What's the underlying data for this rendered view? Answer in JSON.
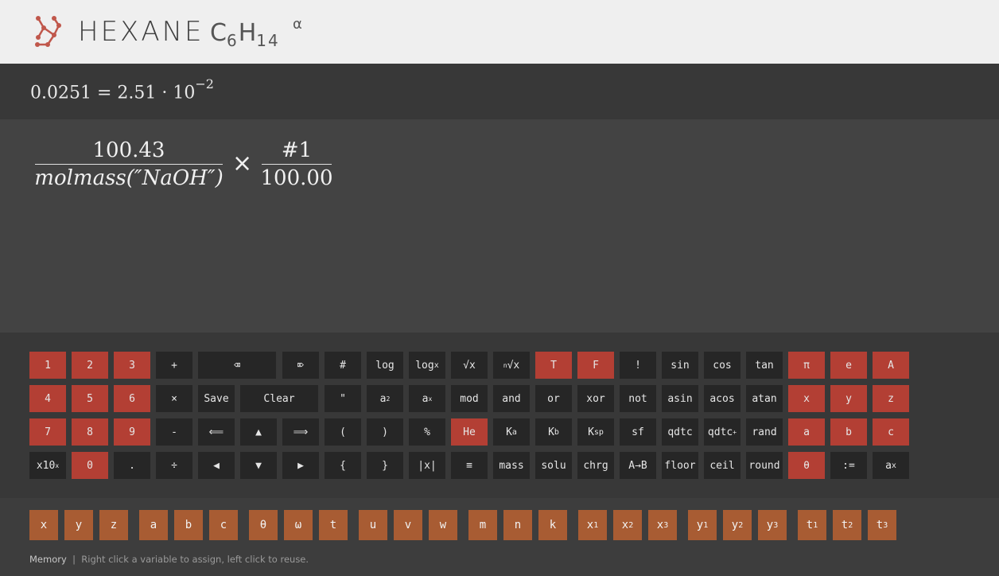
{
  "header": {
    "title": "HEXANE",
    "formula_c": "C",
    "formula_c_sub": "6",
    "formula_h": "H",
    "formula_h_sub": "14",
    "badge": "α"
  },
  "result": {
    "value": "0.0251 = 2.51 · 10",
    "exponent": "−2"
  },
  "expression": {
    "frac1_num": "100.43",
    "frac1_den": "molmass(″NaOH″)",
    "operator": "×",
    "frac2_num": "#1",
    "frac2_den": "100.00"
  },
  "keys": {
    "k1": "1",
    "k2": "2",
    "k3": "3",
    "plus": "+",
    "backspace": "⌫",
    "delete": "⌦",
    "hash": "#",
    "log": "log",
    "logx": "log",
    "logx_sub": "x",
    "sqrt": "√x",
    "nroot": "√x",
    "nroot_sup": "n",
    "true": "T",
    "false": "F",
    "fact": "!",
    "sin": "sin",
    "cos": "cos",
    "tan": "tan",
    "pi": "π",
    "e": "e",
    "A": "A",
    "k4": "4",
    "k5": "5",
    "k6": "6",
    "mul": "×",
    "save": "Save",
    "clear": "Clear",
    "quote": "\"",
    "sq": "a",
    "sq_sup": "2",
    "pow": "a",
    "pow_sup": "x",
    "mod": "mod",
    "and": "and",
    "or": "or",
    "xor": "xor",
    "not": "not",
    "asin": "asin",
    "acos": "acos",
    "atan": "atan",
    "x": "x",
    "y": "y",
    "z": "z",
    "k7": "7",
    "k8": "8",
    "k9": "9",
    "minus": "-",
    "left_dbl": "⟸",
    "up": "▲",
    "right_dbl": "⟹",
    "lparen": "(",
    "rparen": ")",
    "percent": "%",
    "he": "He",
    "ka": "K",
    "ka_sub": "a",
    "kb": "K",
    "kb_sub": "b",
    "ksp": "K",
    "ksp_sub": "sp",
    "sf": "sf",
    "qdtc": "qdtc",
    "qdtcp": "qdtc",
    "qdtcp_sup": "+",
    "rand": "rand",
    "a": "a",
    "b": "b",
    "c": "c",
    "x10": "x10",
    "x10_sup": "x",
    "k0": "0",
    "dot": ".",
    "div": "÷",
    "left": "◀",
    "down": "▼",
    "right": "▶",
    "lbrace": "{",
    "rbrace": "}",
    "abs": "|x|",
    "menu": "≡",
    "mass": "mass",
    "solu": "solu",
    "chrg": "chrg",
    "atob": "A→B",
    "floor": "floor",
    "ceil": "ceil",
    "round": "round",
    "theta": "θ",
    "assign": ":=",
    "ax": "a",
    "ax_sub": "x"
  },
  "memory": {
    "vars": [
      "x",
      "y",
      "z",
      "a",
      "b",
      "c",
      "θ",
      "ω",
      "t",
      "u",
      "v",
      "w",
      "m",
      "n",
      "k",
      "x",
      "x",
      "x",
      "y",
      "y",
      "y",
      "t",
      "t",
      "t"
    ],
    "subs": [
      "",
      "",
      "",
      "",
      "",
      "",
      "",
      "",
      "",
      "",
      "",
      "",
      "",
      "",
      "",
      "1",
      "2",
      "3",
      "1",
      "2",
      "3",
      "1",
      "2",
      "3"
    ],
    "label": "Memory",
    "separator": "|",
    "note": "Right click a variable to assign, left click to reuse."
  },
  "colors": {
    "accent_red": "#b33f34",
    "memory_orange": "#a85c33",
    "key_dark": "#262626"
  }
}
